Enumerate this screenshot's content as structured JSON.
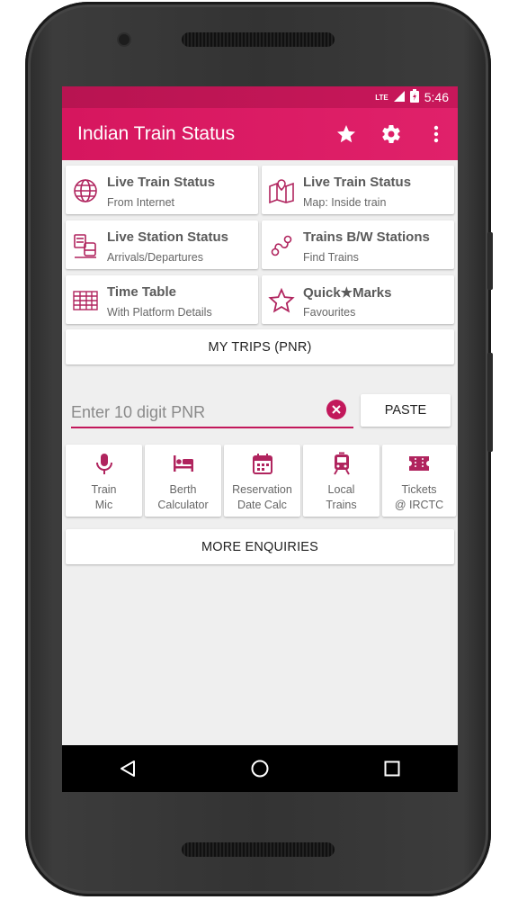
{
  "status_bar": {
    "network": "LTE",
    "time": "5:46"
  },
  "toolbar": {
    "title": "Indian Train Status",
    "icons": [
      "star-icon",
      "gear-icon",
      "overflow-menu-icon"
    ]
  },
  "tiles": [
    {
      "title": "Live Train Status",
      "subtitle": "From Internet",
      "icon": "globe-icon"
    },
    {
      "title": "Live Train Status",
      "subtitle": "Map: Inside train",
      "icon": "map-icon"
    },
    {
      "title": "Live Station Status",
      "subtitle": "Arrivals/Departures",
      "icon": "station-board-icon"
    },
    {
      "title": "Trains B/W Stations",
      "subtitle": "Find Trains",
      "icon": "route-icon"
    },
    {
      "title": "Time Table",
      "subtitle": "With Platform Details",
      "icon": "timetable-icon"
    },
    {
      "title": "Quick★Marks",
      "subtitle": "Favourites",
      "icon": "star-outline-icon"
    }
  ],
  "my_trips_label": "MY TRIPS (PNR)",
  "pnr": {
    "placeholder": "Enter 10 digit PNR",
    "value": "",
    "paste_label": "PASTE"
  },
  "enquiries": [
    {
      "line1": "Train",
      "line2": "Mic",
      "icon": "microphone-icon"
    },
    {
      "line1": "Berth",
      "line2": "Calculator",
      "icon": "bed-icon"
    },
    {
      "line1": "Reservation",
      "line2": "Date Calc",
      "icon": "calendar-icon"
    },
    {
      "line1": "Local",
      "line2": "Trains",
      "icon": "train-icon"
    },
    {
      "line1": "Tickets",
      "line2": "@ IRCTC",
      "icon": "ticket-icon"
    }
  ],
  "more_enquiries_label": "MORE ENQUIRIES",
  "nav_bar": [
    "back-icon",
    "home-icon",
    "recents-icon"
  ],
  "colors": {
    "primary": "#e0216a",
    "primary_dark": "#b81451",
    "icon_accent": "#b0245e",
    "background": "#efefef"
  }
}
